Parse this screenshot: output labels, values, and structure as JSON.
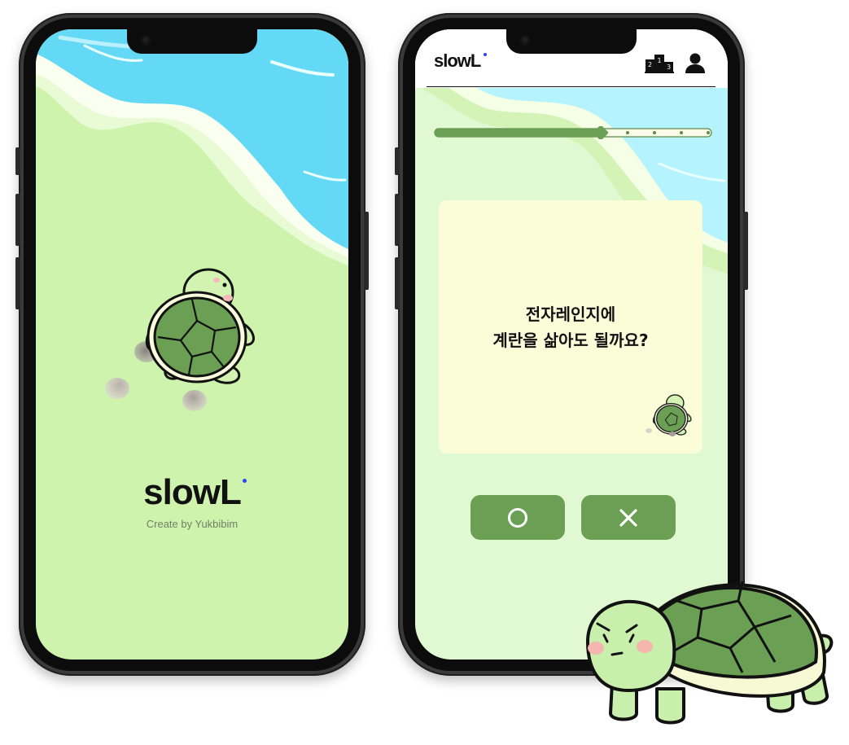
{
  "splash": {
    "logo": "slowL",
    "credit": "Create by Yukbibim"
  },
  "quiz": {
    "logo": "slowL",
    "progress": 0.6,
    "question_line1": "전자레인지에",
    "question_line2": "계란을 삶아도 될까요?",
    "answers": {
      "yes": "O",
      "no": "X"
    },
    "icons": {
      "ranking": "podium-icon",
      "profile": "user-icon"
    },
    "podium_digits": [
      "2",
      "1",
      "3"
    ]
  },
  "colors": {
    "accent_green": "#6a9f54",
    "grass": "#cdf3ad",
    "sea": "#63d9f6",
    "card": "#fbfdd8",
    "logo_dot": "#2e42ff"
  }
}
